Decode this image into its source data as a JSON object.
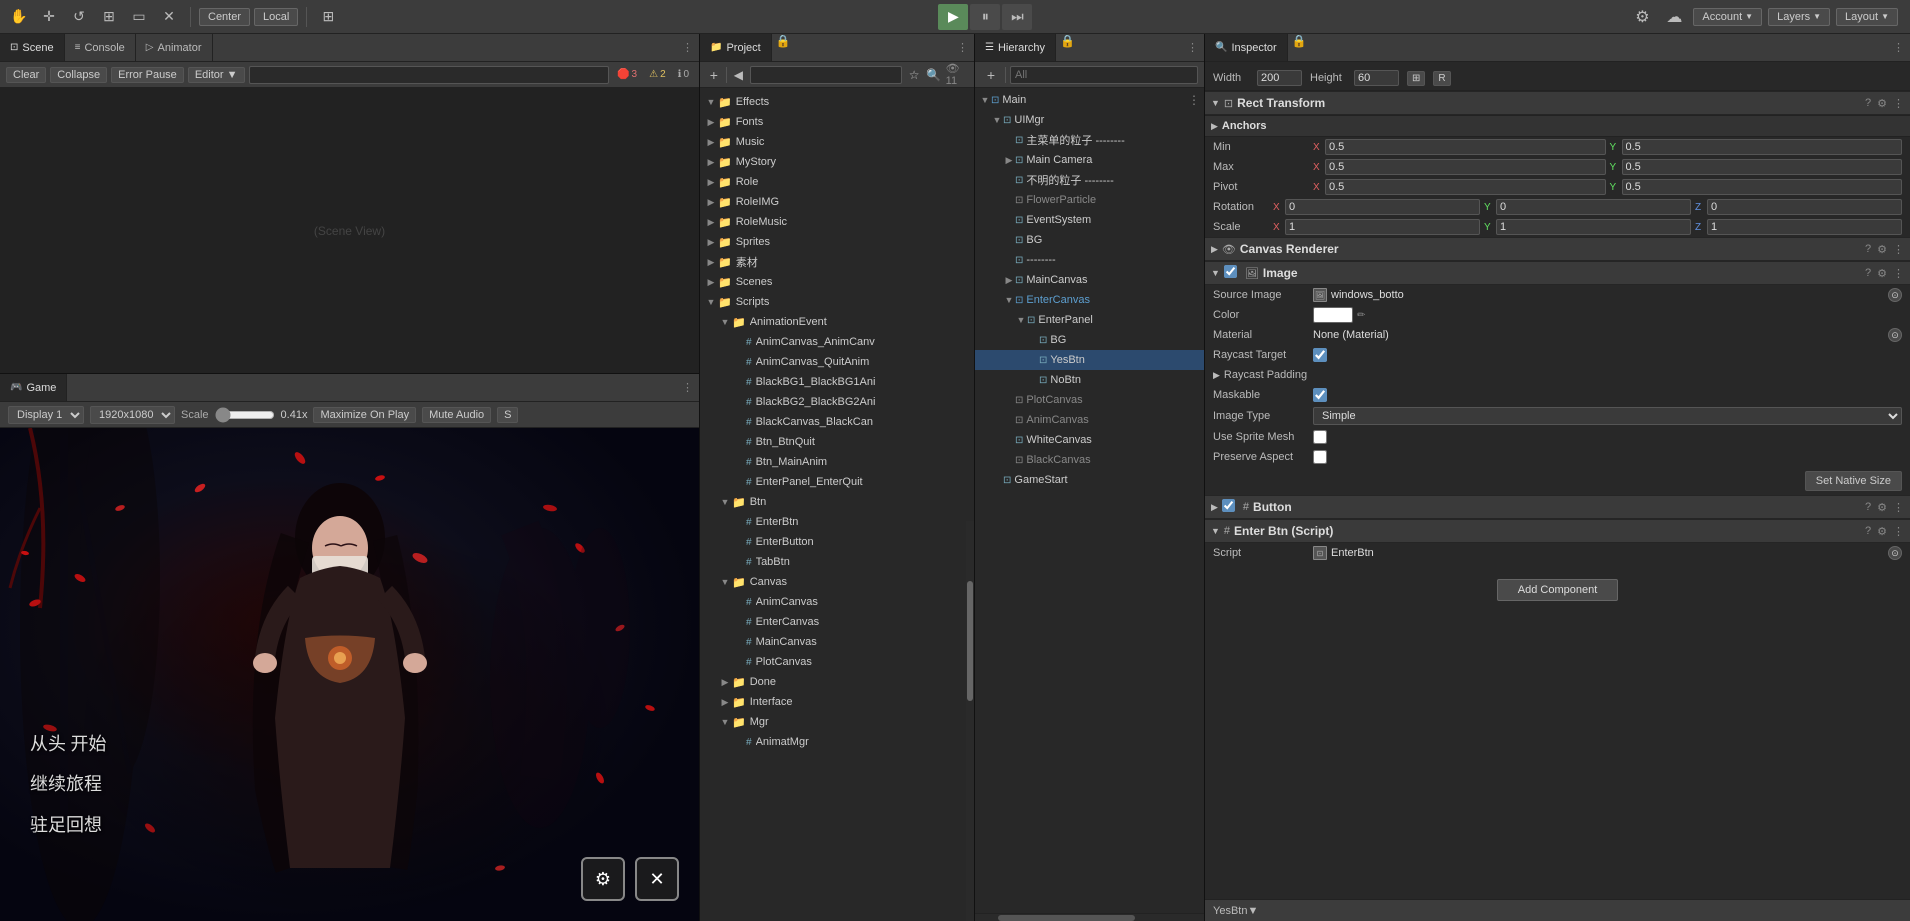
{
  "toolbar": {
    "tools": [
      "hand",
      "move",
      "rotate",
      "scale",
      "rect",
      "transform"
    ],
    "center_label": "Center",
    "local_label": "Local",
    "play_label": "▶",
    "pause_label": "⏸",
    "step_label": "⏭",
    "account_label": "Account",
    "layers_label": "Layers",
    "layout_label": "Layout"
  },
  "scene_panel": {
    "tabs": [
      "Scene",
      "Console",
      "Animator"
    ],
    "active_tab": "Scene",
    "toolbar": {
      "clear_label": "Clear",
      "collapse_label": "Collapse",
      "error_pause_label": "Error Pause",
      "editor_label": "Editor",
      "badge_error": "3",
      "badge_warn": "2",
      "badge_info": "0"
    }
  },
  "game_panel": {
    "tab_label": "Game",
    "display_label": "Display 1",
    "resolution_label": "1920x1080",
    "scale_label": "Scale",
    "scale_value": "0.41x",
    "maximize_label": "Maximize On Play",
    "mute_label": "Mute Audio",
    "s_label": "S",
    "text_lines": [
      "从头 开始",
      "继续旅程",
      "驻足回想"
    ]
  },
  "project_panel": {
    "tab_label": "Project",
    "toolbar": {
      "add_icon": "+",
      "search_placeholder": "",
      "count_label": "11"
    },
    "tree": [
      {
        "label": "Effects",
        "type": "folder",
        "indent": 0,
        "expanded": true
      },
      {
        "label": "Fonts",
        "type": "folder",
        "indent": 0,
        "expanded": false
      },
      {
        "label": "Music",
        "type": "folder",
        "indent": 0,
        "expanded": false
      },
      {
        "label": "MyStory",
        "type": "folder",
        "indent": 0,
        "expanded": false
      },
      {
        "label": "Role",
        "type": "folder",
        "indent": 0,
        "expanded": false
      },
      {
        "label": "RoleIMG",
        "type": "folder",
        "indent": 0,
        "expanded": false
      },
      {
        "label": "RoleMusic",
        "type": "folder",
        "indent": 0,
        "expanded": false
      },
      {
        "label": "Sprites",
        "type": "folder",
        "indent": 0,
        "expanded": false
      },
      {
        "label": "素材",
        "type": "folder",
        "indent": 0,
        "expanded": false
      },
      {
        "label": "Scenes",
        "type": "folder",
        "indent": 0,
        "expanded": false
      },
      {
        "label": "Scripts",
        "type": "folder",
        "indent": 0,
        "expanded": true
      },
      {
        "label": "AnimationEvent",
        "type": "folder",
        "indent": 1,
        "expanded": true
      },
      {
        "label": "AnimCanvas_AnimCanv",
        "type": "script",
        "indent": 2
      },
      {
        "label": "AnimCanvas_QuitAnim",
        "type": "script",
        "indent": 2
      },
      {
        "label": "BlackBG1_BlackBG1Ani",
        "type": "script",
        "indent": 2
      },
      {
        "label": "BlackBG2_BlackBG2Ani",
        "type": "script",
        "indent": 2
      },
      {
        "label": "BlackCanvas_BlackCan",
        "type": "script",
        "indent": 2
      },
      {
        "label": "Btn_BtnQuit",
        "type": "script",
        "indent": 2
      },
      {
        "label": "Btn_MainAnim",
        "type": "script",
        "indent": 2
      },
      {
        "label": "EnterPanel_EnterQuit",
        "type": "script",
        "indent": 2
      },
      {
        "label": "Btn",
        "type": "folder",
        "indent": 1,
        "expanded": true
      },
      {
        "label": "EnterBtn",
        "type": "script",
        "indent": 2
      },
      {
        "label": "EnterButton",
        "type": "script",
        "indent": 2
      },
      {
        "label": "TabBtn",
        "type": "script",
        "indent": 2
      },
      {
        "label": "Canvas",
        "type": "folder",
        "indent": 1,
        "expanded": true
      },
      {
        "label": "AnimCanvas",
        "type": "script",
        "indent": 2
      },
      {
        "label": "EnterCanvas",
        "type": "script",
        "indent": 2
      },
      {
        "label": "MainCanvas",
        "type": "script",
        "indent": 2
      },
      {
        "label": "PlotCanvas",
        "type": "script",
        "indent": 2
      },
      {
        "label": "Done",
        "type": "folder",
        "indent": 1,
        "expanded": false
      },
      {
        "label": "Interface",
        "type": "folder",
        "indent": 1,
        "expanded": false
      },
      {
        "label": "Mgr",
        "type": "folder",
        "indent": 1,
        "expanded": true
      },
      {
        "label": "AnimatMgr",
        "type": "script",
        "indent": 2
      }
    ]
  },
  "hierarchy_panel": {
    "tab_label": "Hierarchy",
    "search_placeholder": "All",
    "tree": [
      {
        "label": "Main",
        "type": "scene",
        "indent": 0,
        "expanded": true,
        "has_more": true
      },
      {
        "label": "UIMgr",
        "type": "cube",
        "indent": 1,
        "expanded": true
      },
      {
        "label": "主菜单的粒子 --------",
        "type": "cube",
        "indent": 2
      },
      {
        "label": "Main Camera",
        "type": "cube",
        "indent": 2,
        "expanded": false
      },
      {
        "label": "不明的粒子 --------",
        "type": "cube",
        "indent": 2
      },
      {
        "label": "FlowerParticle",
        "type": "cube",
        "indent": 2,
        "dimmed": true
      },
      {
        "label": "EventSystem",
        "type": "cube",
        "indent": 2
      },
      {
        "label": "BG",
        "type": "cube",
        "indent": 2
      },
      {
        "label": "--------",
        "type": "cube",
        "indent": 2
      },
      {
        "label": "MainCanvas",
        "type": "cube",
        "indent": 2,
        "expanded": false
      },
      {
        "label": "EnterCanvas",
        "type": "cube",
        "indent": 2,
        "expanded": true,
        "highlighted": true
      },
      {
        "label": "EnterPanel",
        "type": "cube",
        "indent": 3,
        "expanded": true
      },
      {
        "label": "BG",
        "type": "cube",
        "indent": 4
      },
      {
        "label": "YesBtn",
        "type": "cube",
        "indent": 4
      },
      {
        "label": "NoBtn",
        "type": "cube",
        "indent": 4
      },
      {
        "label": "PlotCanvas",
        "type": "cube",
        "indent": 2,
        "dimmed": true
      },
      {
        "label": "AnimCanvas",
        "type": "cube",
        "indent": 2,
        "dimmed": true
      },
      {
        "label": "WhiteCanvas",
        "type": "cube",
        "indent": 2
      },
      {
        "label": "BlackCanvas",
        "type": "cube",
        "indent": 2,
        "dimmed": true
      },
      {
        "label": "GameStart",
        "type": "cube",
        "indent": 1
      }
    ]
  },
  "inspector_panel": {
    "tab_label": "Inspector",
    "rect_transform": {
      "label": "Rect Transform",
      "width_label": "Width",
      "height_label": "Height",
      "width_value": "200",
      "height_value": "60",
      "anchors_label": "Anchors",
      "min_label": "Min",
      "min_x": "0.5",
      "min_y": "0.5",
      "max_label": "Max",
      "max_x": "0.5",
      "max_y": "0.5",
      "pivot_label": "Pivot",
      "pivot_x": "0.5",
      "pivot_y": "0.5",
      "rotation_label": "Rotation",
      "rotation_x": "0",
      "rotation_y": "0",
      "rotation_z": "0",
      "scale_label": "Scale",
      "scale_x": "1",
      "scale_y": "1",
      "scale_z": "1"
    },
    "canvas_renderer": {
      "label": "Canvas Renderer"
    },
    "image_component": {
      "label": "Image",
      "source_image_label": "Source Image",
      "source_image_value": "windows_botto",
      "color_label": "Color",
      "material_label": "Material",
      "material_value": "None (Material)",
      "raycast_target_label": "Raycast Target",
      "raycast_padding_label": "Raycast Padding",
      "maskable_label": "Maskable",
      "image_type_label": "Image Type",
      "image_type_value": "Simple",
      "use_sprite_mesh_label": "Use Sprite Mesh",
      "preserve_aspect_label": "Preserve Aspect",
      "set_native_size_label": "Set Native Size"
    },
    "button_component": {
      "label": "Button"
    },
    "enter_btn_script": {
      "label": "Enter Btn (Script)",
      "script_label": "Script",
      "script_value": "EnterBtn"
    },
    "add_component_label": "Add Component",
    "bottom_label": "YesBtn▼"
  }
}
